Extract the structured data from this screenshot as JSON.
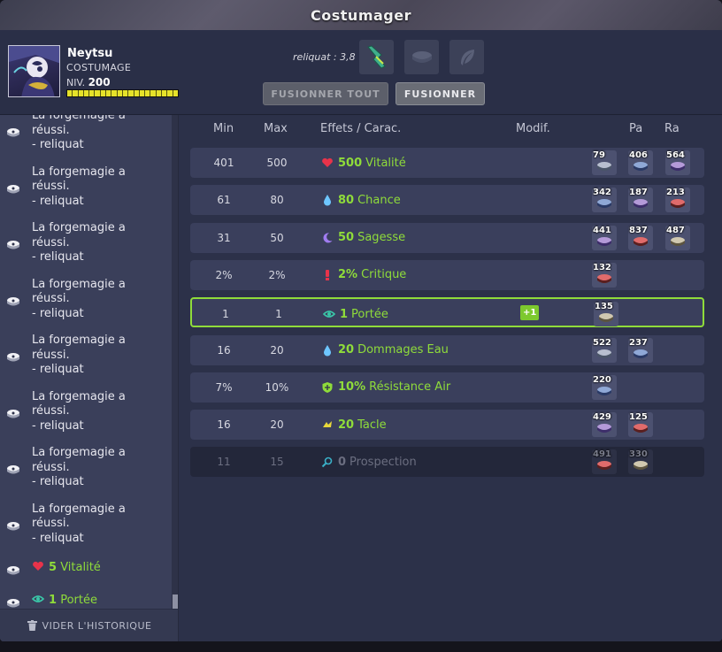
{
  "window": {
    "title": "Costumager"
  },
  "character": {
    "name": "Neytsu",
    "class": "COSTUMAGE",
    "level_label": "NIV.",
    "level": "200",
    "xp_fraction": 1.0
  },
  "reliquat": {
    "label": "reliquat : 3,8"
  },
  "buttons": {
    "merge_all": "FUSIONNER TOUT",
    "merge": "FUSIONNER"
  },
  "history": {
    "items": [
      {
        "text": "La forgemagie a\nréussi.\n- reliquat",
        "kind": "msg"
      },
      {
        "text": "La forgemagie a\nréussi.\n- reliquat",
        "kind": "msg"
      },
      {
        "text": "La forgemagie a\nréussi.\n- reliquat",
        "kind": "msg"
      },
      {
        "text": "La forgemagie a\nréussi.\n- reliquat",
        "kind": "msg"
      },
      {
        "text": "La forgemagie a\nréussi.\n- reliquat",
        "kind": "msg"
      },
      {
        "text": "La forgemagie a\nréussi.\n- reliquat",
        "kind": "msg"
      },
      {
        "text": "La forgemagie a\nréussi.\n- reliquat",
        "kind": "msg"
      },
      {
        "text": "La forgemagie a\nréussi.\n- reliquat",
        "kind": "msg"
      },
      {
        "value": "5",
        "stat": "Vitalité",
        "kind": "stat",
        "icon": "heart-icon"
      },
      {
        "value": "1",
        "stat": "Portée",
        "kind": "stat",
        "icon": "eye-icon"
      }
    ],
    "clear_label": "VIDER L'HISTORIQUE"
  },
  "table": {
    "headers": {
      "min": "Min",
      "max": "Max",
      "effects": "Effets / Carac.",
      "modif": "Modif.",
      "pa": "Pa",
      "ra": "Ra"
    },
    "rows": [
      {
        "min": "401",
        "max": "500",
        "value": "500",
        "stat": "Vitalité",
        "icon": "heart-icon",
        "icon_color": "#e8334a",
        "runes": [
          "79",
          "406",
          "564"
        ],
        "state": "normal"
      },
      {
        "min": "61",
        "max": "80",
        "value": "80",
        "stat": "Chance",
        "icon": "water-drop-icon",
        "icon_color": "#6ec6ff",
        "runes": [
          "342",
          "187",
          "213"
        ],
        "state": "normal"
      },
      {
        "min": "31",
        "max": "50",
        "value": "50",
        "stat": "Sagesse",
        "icon": "moon-icon",
        "icon_color": "#a07cf0",
        "runes": [
          "441",
          "837",
          "487"
        ],
        "state": "normal"
      },
      {
        "min": "2%",
        "max": "2%",
        "value": "2%",
        "stat": "Critique",
        "icon": "exclamation-icon",
        "icon_color": "#e8334a",
        "runes": [
          "132"
        ],
        "state": "normal"
      },
      {
        "min": "1",
        "max": "1",
        "value": "1",
        "stat": "Portée",
        "icon": "eye-icon",
        "icon_color": "#3ac7a8",
        "runes": [
          "135"
        ],
        "state": "active",
        "modif": "+1"
      },
      {
        "min": "16",
        "max": "20",
        "value": "20",
        "stat": "Dommages Eau",
        "icon": "water-drop-icon",
        "icon_color": "#6ec6ff",
        "runes": [
          "522",
          "237"
        ],
        "state": "normal"
      },
      {
        "min": "7%",
        "max": "10%",
        "value": "10%",
        "stat": "Résistance Air",
        "icon": "shield-icon",
        "icon_color": "#8fdc3a",
        "runes": [
          "220"
        ],
        "state": "normal"
      },
      {
        "min": "16",
        "max": "20",
        "value": "20",
        "stat": "Tacle",
        "icon": "tackle-icon",
        "icon_color": "#e8d83a",
        "runes": [
          "429",
          "125"
        ],
        "state": "normal"
      },
      {
        "min": "11",
        "max": "15",
        "value": "0",
        "stat": "Prospection",
        "icon": "magnifier-icon",
        "icon_color": "#3ab0c7",
        "runes": [
          "491",
          "330"
        ],
        "state": "dim"
      }
    ]
  }
}
